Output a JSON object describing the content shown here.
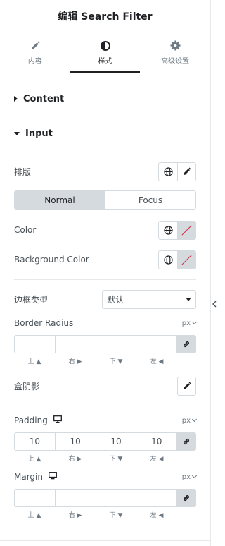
{
  "header": {
    "title": "编辑 Search Filter"
  },
  "tabs": [
    {
      "label": "内容",
      "icon": "pencil-icon",
      "active": false
    },
    {
      "label": "样式",
      "icon": "half-circle-icon",
      "active": true
    },
    {
      "label": "高级设置",
      "icon": "gear-icon",
      "active": false
    }
  ],
  "sections": {
    "content": {
      "title": "Content",
      "expanded": false
    },
    "input": {
      "title": "Input",
      "expanded": true
    }
  },
  "controls": {
    "typography": {
      "label": "排版"
    },
    "state_toggle": {
      "normal": "Normal",
      "focus": "Focus",
      "selected": "Normal"
    },
    "color": {
      "label": "Color"
    },
    "background_color": {
      "label": "Background Color"
    },
    "border_type": {
      "label": "边框类型",
      "value": "默认"
    },
    "border_radius": {
      "label": "Border Radius",
      "unit": "px",
      "values": [
        "",
        "",
        "",
        ""
      ],
      "sides": [
        "上 ▲",
        "右 ▶",
        "下 ▼",
        "左 ◀"
      ]
    },
    "box_shadow": {
      "label": "盒阴影"
    },
    "padding": {
      "label": "Padding",
      "unit": "px",
      "values": [
        "10",
        "10",
        "10",
        "10"
      ],
      "sides": [
        "上 ▲",
        "右 ▶",
        "下 ▼",
        "左 ◀"
      ]
    },
    "margin": {
      "label": "Margin",
      "unit": "px",
      "values": [
        "",
        "",
        "",
        ""
      ],
      "sides": [
        "上 ▲",
        "右 ▶",
        "下 ▼",
        "左 ◀"
      ]
    }
  },
  "colors": {
    "accent": "#1f2124",
    "border": "#d5dadf",
    "text": "#495157",
    "no_color_slash": "#d72b3f"
  }
}
